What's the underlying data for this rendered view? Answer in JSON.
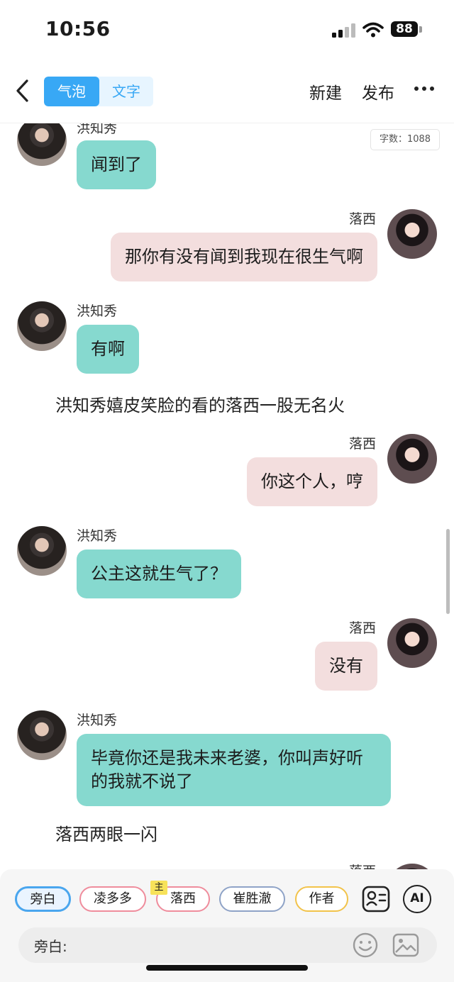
{
  "status": {
    "time": "10:56",
    "battery": "88"
  },
  "nav": {
    "tab_bubble": "气泡",
    "tab_text": "文字",
    "new_label": "新建",
    "publish_label": "发布"
  },
  "word_count": "字数：1088",
  "messages": [
    {
      "name": "洪知秀",
      "text": "闻到了"
    },
    {
      "name": "落西",
      "text": "那你有没有闻到我现在很生气啊"
    },
    {
      "name": "洪知秀",
      "text": "有啊"
    },
    {
      "narration": "洪知秀嬉皮笑脸的看的落西一股无名火"
    },
    {
      "name": "落西",
      "text": "你这个人，哼"
    },
    {
      "name": "洪知秀",
      "text": "公主这就生气了？"
    },
    {
      "name": "落西",
      "text": "没有"
    },
    {
      "name": "洪知秀",
      "text": "毕竟你还是我未来老婆，你叫声好听的我就不说了"
    },
    {
      "narration": "落西两眼一闪"
    },
    {
      "name": "落西",
      "text": ""
    }
  ],
  "roles": [
    {
      "label": "旁白"
    },
    {
      "label": "凌多多"
    },
    {
      "label": "落西",
      "tag": "主"
    },
    {
      "label": "崔胜澈"
    },
    {
      "label": "作者"
    }
  ],
  "input": {
    "label": "旁白:"
  },
  "ai_label": "AI",
  "colors": {
    "accent": "#38a8f5",
    "bubble_left": "#86d9cf",
    "bubble_right": "#f3dede"
  }
}
